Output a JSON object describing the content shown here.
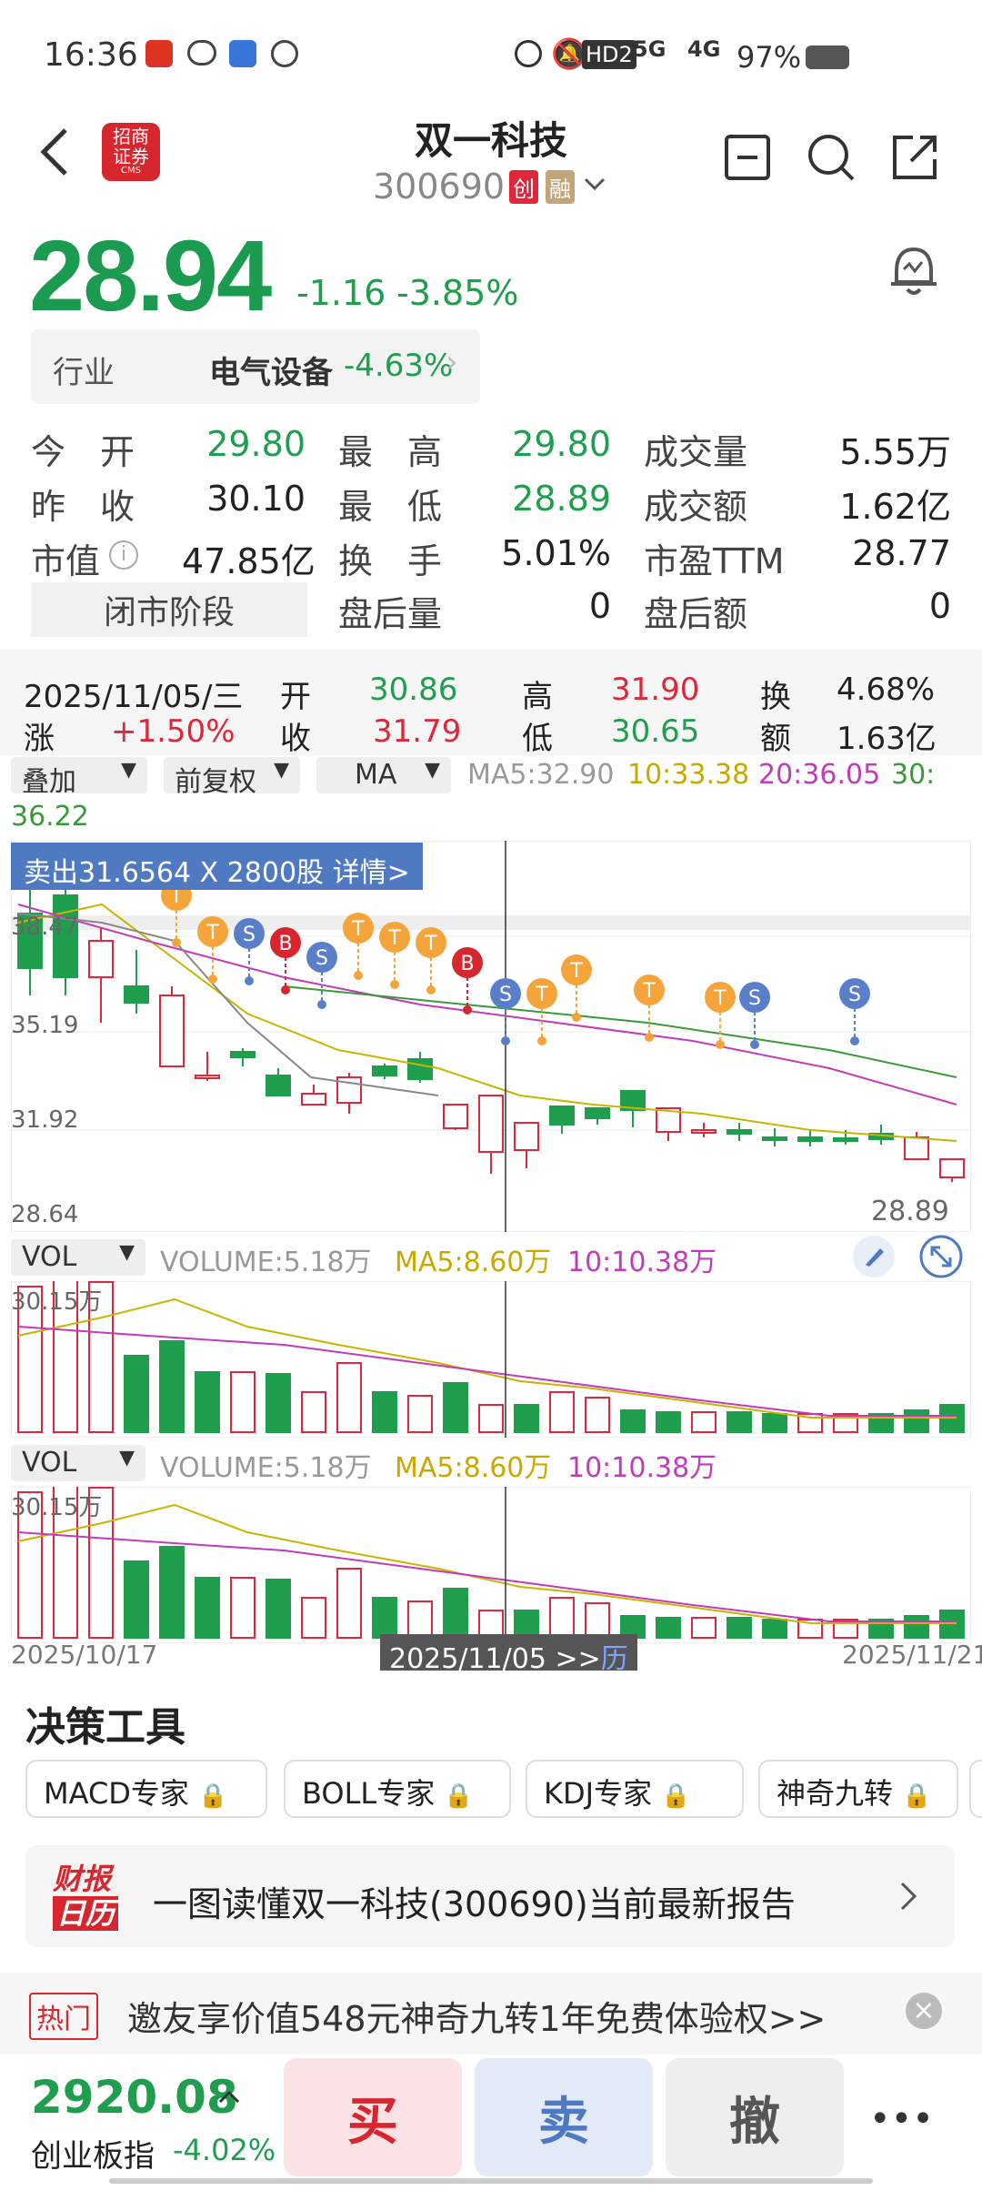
{
  "status_bar": {
    "time": "16:36",
    "net1": "HD2",
    "net2": "5G",
    "net3": "4G",
    "battery": "97%"
  },
  "header": {
    "broker": "招商证券",
    "broker_sub": "CMS",
    "stock_name": "双一科技",
    "stock_code": "300690",
    "badge1": "创",
    "badge2": "融"
  },
  "quote": {
    "price": "28.94",
    "change": "-1.16",
    "change_pct": "-3.85%"
  },
  "industry": {
    "label": "行业",
    "name": "电气设备",
    "pct": "-4.63%"
  },
  "stats": [
    {
      "label": "今　开",
      "value": "29.80",
      "color": "g"
    },
    {
      "label": "最　高",
      "value": "29.80",
      "color": "g"
    },
    {
      "label": "成交量",
      "value": "5.55万",
      "color": ""
    },
    {
      "label": "昨　收",
      "value": "30.10",
      "color": ""
    },
    {
      "label": "最　低",
      "value": "28.89",
      "color": "g"
    },
    {
      "label": "成交额",
      "value": "1.62亿",
      "color": ""
    },
    {
      "label": "市值",
      "value": "47.85亿",
      "color": ""
    },
    {
      "label": "换　手",
      "value": "5.01%",
      "color": ""
    },
    {
      "label": "市盈TTM",
      "value": "28.77",
      "color": ""
    },
    {
      "label": "闭市阶段",
      "value": "",
      "color": ""
    },
    {
      "label": "盘后量",
      "value": "0",
      "color": ""
    },
    {
      "label": "盘后额",
      "value": "0",
      "color": ""
    }
  ],
  "day_info": {
    "date": "2025/11/05/三",
    "open_label": "开",
    "open": "30.86",
    "high_label": "高",
    "high": "31.90",
    "turnover_label": "换",
    "turnover": "4.68%",
    "chg_label": "涨",
    "chg": "+1.50%",
    "close_label": "收",
    "close": "31.79",
    "low_label": "低",
    "low": "30.65",
    "amount_label": "额",
    "amount": "1.63亿"
  },
  "chart_controls": {
    "overlay": "叠加",
    "adjust": "前复权",
    "indicator": "MA",
    "ma5": "MA5:32.90",
    "ma10": "10:33.38",
    "ma20": "20:36.05",
    "ma30_label": "30:",
    "ma30": "36.22"
  },
  "trade_banner": "卖出31.6564 X 2800股 详情>",
  "kline_axis": {
    "y1": "38.47",
    "y2": "35.19",
    "y3": "31.92",
    "y4": "28.64",
    "last": "28.89"
  },
  "vol1": {
    "label": "VOL",
    "volume": "VOLUME:5.18万",
    "ma5": "MA5:8.60万",
    "ma10": "10:10.38万",
    "ymax": "30.15万"
  },
  "vol2": {
    "label": "VOL",
    "volume": "VOLUME:5.18万",
    "ma5": "MA5:8.60万",
    "ma10": "10:10.38万",
    "ymax": "30.15万"
  },
  "date_axis": {
    "start": "2025/10/17",
    "cursor": "2025/11/05 >>",
    "cursor_tail": "历",
    "end": "2025/11/21"
  },
  "tools": {
    "title": "决策工具",
    "items": [
      "MACD专家",
      "BOLL专家",
      "KDJ专家",
      "神奇九转"
    ]
  },
  "report": {
    "logo_top": "财报",
    "logo_bottom": "日历",
    "text": "一图读懂双一科技(300690)当前最新报告"
  },
  "promo": {
    "tag": "热门",
    "text": "邀友享价值548元神奇九转1年免费体验权>>"
  },
  "bottom": {
    "index_value": "2920.08",
    "index_name": "创业板指",
    "index_pct": "-4.02%",
    "buy": "买",
    "sell": "卖",
    "cancel": "撤",
    "more": "•••"
  },
  "colors": {
    "up": "#e0263a",
    "down": "#1f9e4e",
    "ma5": "#c9b400",
    "ma10": "#c23bb8",
    "ma20": "#3a9a3a",
    "trade_t": "#f4a43a",
    "trade_s": "#5a7fc9",
    "trade_b": "#d8262e"
  }
}
